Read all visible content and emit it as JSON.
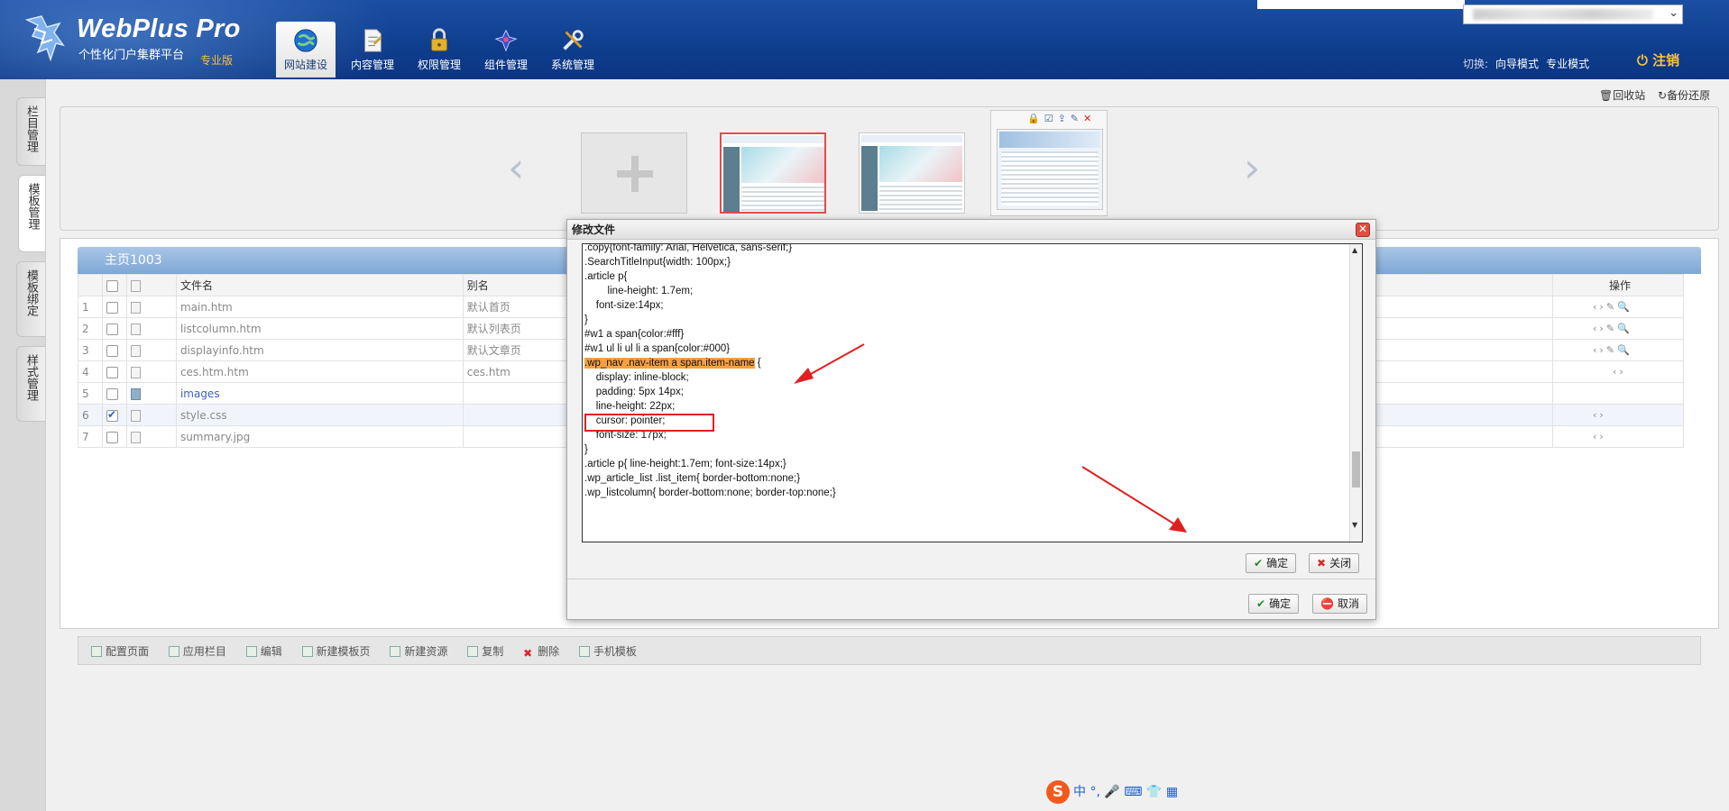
{
  "header": {
    "brand": "WebPlus Pro",
    "tagline": "个性化门户集群平台",
    "edition": "专业版",
    "nav": [
      {
        "label": "网站建设",
        "icon": "globe-icon",
        "active": true
      },
      {
        "label": "内容管理",
        "icon": "document-icon",
        "active": false
      },
      {
        "label": "权限管理",
        "icon": "lock-icon",
        "active": false
      },
      {
        "label": "组件管理",
        "icon": "puzzle-icon",
        "active": false
      },
      {
        "label": "系统管理",
        "icon": "tools-icon",
        "active": false
      }
    ],
    "switch_label": "切换:",
    "mode_guide": "向导模式",
    "mode_pro": "专业模式",
    "logout": "注销"
  },
  "side_tabs": [
    {
      "label": "栏目管理",
      "active": false
    },
    {
      "label": "模板管理",
      "active": true
    },
    {
      "label": "模板绑定",
      "active": false
    },
    {
      "label": "样式管理",
      "active": false
    }
  ],
  "top_actions": {
    "recycle": "回收站",
    "backup": "备份还原"
  },
  "panel": {
    "title": "主页1003"
  },
  "grid": {
    "headers": {
      "filename": "文件名",
      "alias": "别名",
      "ops": "操作"
    },
    "rows": [
      {
        "num": "1",
        "name": "main.htm",
        "alias": "默认首页",
        "checked": false,
        "kind": "file"
      },
      {
        "num": "2",
        "name": "listcolumn.htm",
        "alias": "默认列表页",
        "checked": false,
        "kind": "file"
      },
      {
        "num": "3",
        "name": "displayinfo.htm",
        "alias": "默认文章页",
        "checked": false,
        "kind": "file"
      },
      {
        "num": "4",
        "name": "ces.htm.htm",
        "alias": "ces.htm",
        "checked": false,
        "kind": "file"
      },
      {
        "num": "5",
        "name": "images",
        "alias": "",
        "checked": false,
        "kind": "folder"
      },
      {
        "num": "6",
        "name": "style.css",
        "alias": "",
        "checked": true,
        "kind": "file"
      },
      {
        "num": "7",
        "name": "summary.jpg",
        "alias": "",
        "checked": false,
        "kind": "file"
      }
    ]
  },
  "toolbar": {
    "config_page": "配置页面",
    "apply_column": "应用栏目",
    "edit": "编辑",
    "new_template": "新建模板页",
    "new_resource": "新建资源",
    "copy": "复制",
    "delete": "删除",
    "mobile_template": "手机模板"
  },
  "dialog": {
    "title": "修改文件",
    "code_lines": [
      ".copy{font-family: Arial, Helvetica, sans-serif;}",
      ".SearchTitleInput{width: 100px;}",
      ".article p{",
      "        line-height: 1.7em;",
      "    font-size:14px;",
      "}",
      "",
      "#w1 a span{color:#fff}",
      "#w1 ul li ul li a span{color:#000}",
      "",
      ".wp_nav .nav-item a span.item-name",
      "    display: inline-block;",
      "    padding: 5px 14px;",
      "    line-height: 22px;",
      "    cursor: pointer;",
      "    font-size: 17px;",
      "}",
      "",
      ".article p{ line-height:1.7em; font-size:14px;}",
      ".wp_article_list .list_item{ border-bottom:none;}",
      ".wp_listcolumn{ border-bottom:none; border-top:none;}"
    ],
    "highlight_suffix": " {",
    "inner_ok": "确定",
    "inner_close": "关闭",
    "ok": "确定",
    "cancel": "取消"
  },
  "ime": {
    "logo": "S",
    "lang": "中",
    "punct": "°,"
  },
  "colors": {
    "header_blue": "#0f3f8f",
    "highlight": "#f6a040",
    "annotation_red": "#e02020",
    "logout_gold": "#f7c53a"
  }
}
